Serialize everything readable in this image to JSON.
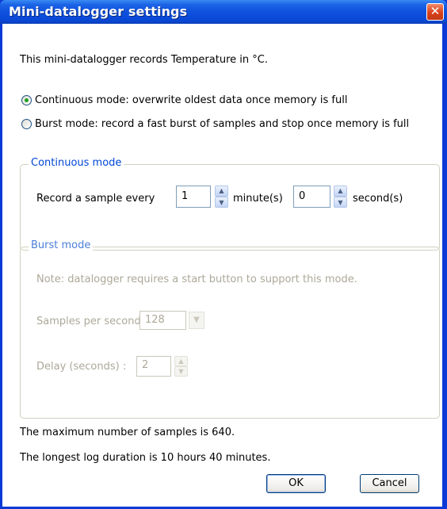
{
  "window": {
    "title": "Mini-datalogger settings",
    "close_glyph": "✕"
  },
  "intro": "This mini-datalogger records Temperature in °C.",
  "modes": {
    "continuous_label": "Continuous mode: overwrite oldest data once memory is full",
    "burst_label": "Burst mode: record a fast burst of samples and stop once memory is full",
    "selected": "continuous"
  },
  "continuous_group": {
    "legend": "Continuous mode",
    "record_label": "Record a sample every",
    "minutes_value": "1",
    "minutes_unit": "minute(s)",
    "seconds_value": "0",
    "seconds_unit": "second(s)"
  },
  "burst_group": {
    "legend": "Burst mode",
    "note": "Note: datalogger requires a start button to support this mode.",
    "samples_label": "Samples per second:",
    "samples_value": "128",
    "delay_label": "Delay (seconds) :",
    "delay_value": "2",
    "enabled": false
  },
  "summary": {
    "max_samples": "The maximum number of samples is 640.",
    "longest_duration": "The longest log duration is 10 hours 40 minutes."
  },
  "buttons": {
    "ok": "OK",
    "cancel": "Cancel"
  },
  "icons": {
    "spin_up": "▲",
    "spin_down": "▼",
    "dropdown": "▼"
  }
}
